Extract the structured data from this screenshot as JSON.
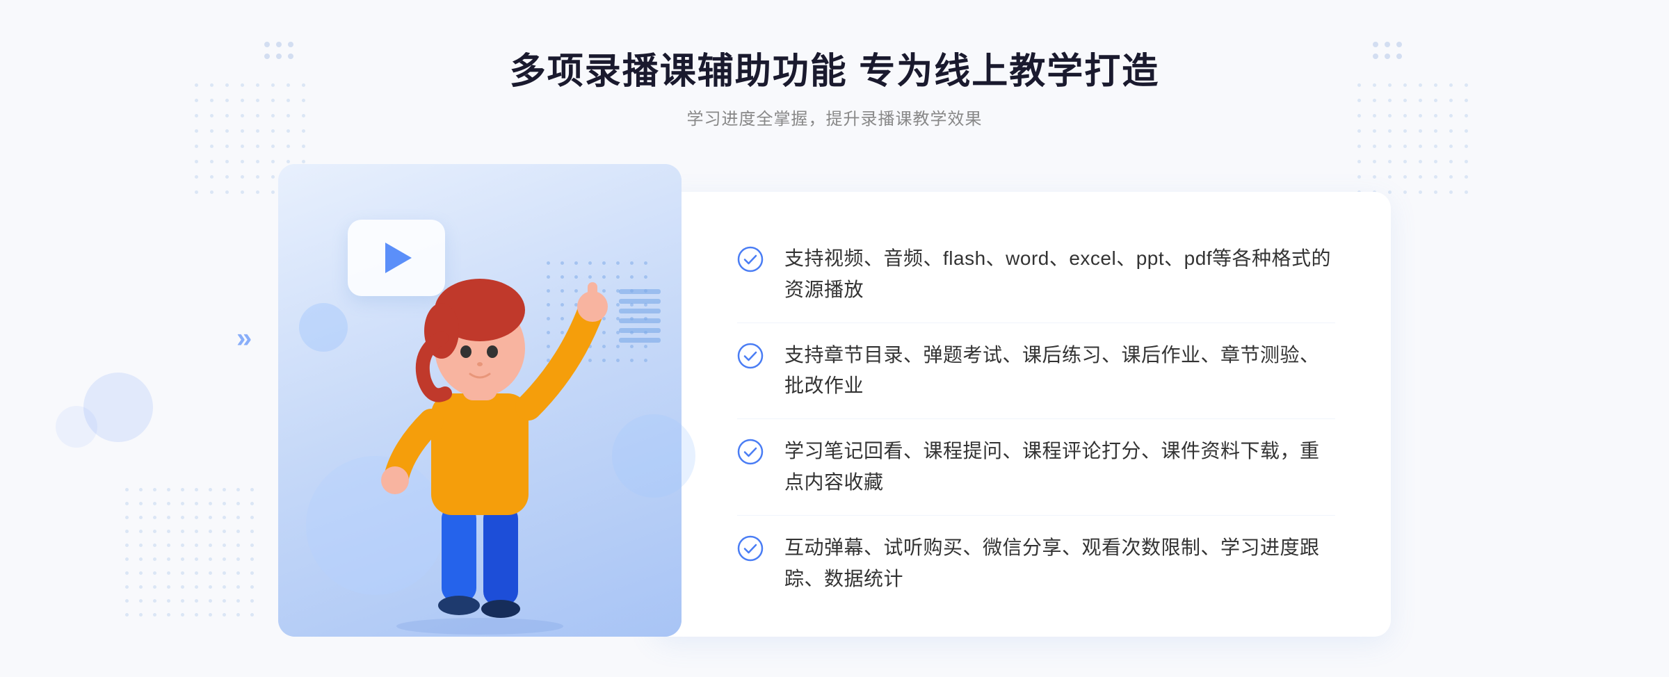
{
  "header": {
    "title": "多项录播课辅助功能 专为线上教学打造",
    "subtitle": "学习进度全掌握，提升录播课教学效果"
  },
  "features": [
    {
      "id": "feature-1",
      "text": "支持视频、音频、flash、word、excel、ppt、pdf等各种格式的资源播放"
    },
    {
      "id": "feature-2",
      "text": "支持章节目录、弹题考试、课后练习、课后作业、章节测验、批改作业"
    },
    {
      "id": "feature-3",
      "text": "学习笔记回看、课程提问、课程评论打分、课件资料下载，重点内容收藏"
    },
    {
      "id": "feature-4",
      "text": "互动弹幕、试听购买、微信分享、观看次数限制、学习进度跟踪、数据统计"
    }
  ],
  "icons": {
    "check": "check-circle-icon",
    "play": "play-icon",
    "chevron": "»"
  },
  "colors": {
    "primary": "#4a7df4",
    "accent": "#2563eb",
    "text_dark": "#1a1a2e",
    "text_mid": "#333333",
    "text_light": "#888888"
  }
}
